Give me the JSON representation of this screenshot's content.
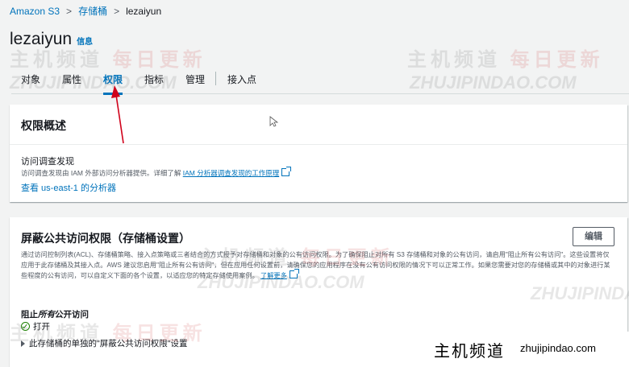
{
  "breadcrumb": {
    "root": "Amazon S3",
    "section": "存储桶",
    "current": "lezaiyun"
  },
  "page": {
    "title": "lezaiyun",
    "info_label": "信息"
  },
  "tabs": [
    {
      "label": "对象",
      "active": false
    },
    {
      "label": "属性",
      "active": false
    },
    {
      "label": "权限",
      "active": true
    },
    {
      "label": "指标",
      "active": false
    },
    {
      "label": "管理",
      "active": false
    },
    {
      "label": "接入点",
      "active": false
    }
  ],
  "permissions_overview": {
    "heading": "权限概述",
    "analyzer_title": "访问调查发现",
    "analyzer_desc": "访问调查发现由 IAM 外部访问分析器提供。详细了解",
    "analyzer_desc_link": "IAM 分析器调查发现的工作原理",
    "analyzer_link": "查看 us-east-1 的分析器"
  },
  "block_public_access": {
    "heading": "屏蔽公共访问权限（存储桶设置）",
    "edit_label": "编辑",
    "description": "通过访问控制列表(ACL)、存储桶策略、接入点策略或三者结合的方式授予对存储桶和对象的公有访问权限。为了确保阻止对所有 S3 存储桶和对象的公有访问，请启用\"阻止所有公有访问\"。这些设置将仅应用于此存储桶及其接入点。AWS 建议您启用\"阻止所有公有访问\"，但在应用任何设置前，请确保您的应用程序在没有公有访问权限的情况下可以正常工作。如果您需要对您的存储桶或其中的对象进行某些程度的公有访问，可以自定义下面的各个设置，以适应您的特定存储使用案例。",
    "learn_more": "了解更多",
    "setting_prefix": "阻止",
    "setting_emph": "所有",
    "setting_suffix": "公开访问",
    "status": "打开",
    "expander_label": "此存储桶的单独的\"屏蔽公共访问权限\"设置"
  },
  "watermarks": {
    "cn": "主机频道",
    "cn_red": "每日更新",
    "en": "ZHUJIPINDAO.COM"
  },
  "brand": {
    "cn": "主机频道",
    "en": "zhujipindao.com"
  },
  "colors": {
    "link": "#0073bb",
    "success": "#1d8102",
    "annotation_arrow": "#d0021b"
  }
}
